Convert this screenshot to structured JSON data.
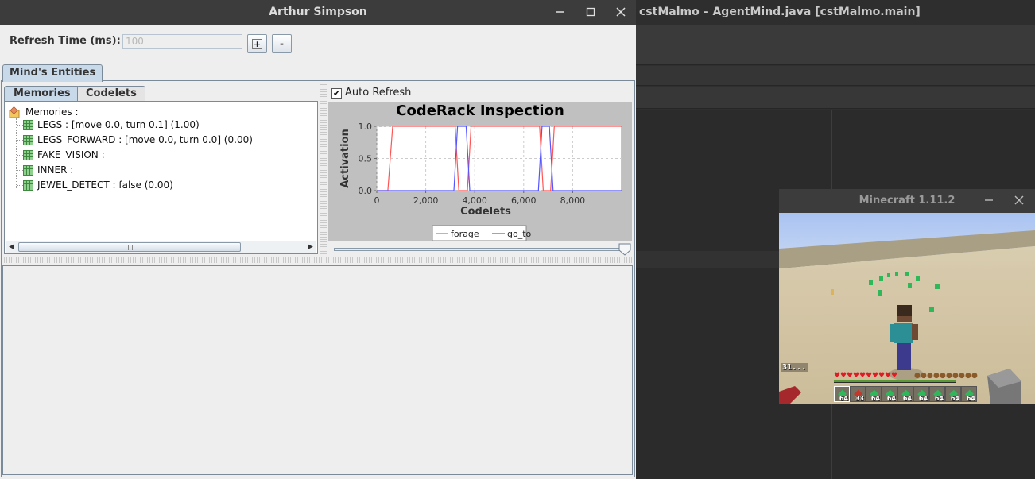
{
  "ide": {
    "title": "cstMalmo – AgentMind.java [cstMalmo.main]"
  },
  "window": {
    "title": "Arthur Simpson",
    "refresh_label": "Refresh Time (ms):",
    "refresh_value": "100",
    "plus_label": "+",
    "minus_label": "-",
    "main_tab": "Mind's Entities",
    "sub_tabs": [
      "Memories",
      "Codelets"
    ],
    "auto_refresh_label": "Auto Refresh",
    "auto_refresh_checked": true,
    "tree": {
      "root": "Memories :",
      "items": [
        "LEGS : [move 0.0, turn 0.1] (1.00)",
        "LEGS_FORWARD : [move 0.0, turn 0.0] (0.00)",
        "FAKE_VISION :",
        "INNER :",
        "JEWEL_DETECT : false (0.00)"
      ]
    },
    "slider_value": 1.0
  },
  "chart_data": {
    "type": "line",
    "title": "CodeRack Inspection",
    "xlabel": "Codelets",
    "ylabel": "Activation",
    "xlim": [
      0,
      10000
    ],
    "ylim": [
      0,
      1.0
    ],
    "xticks": [
      "0",
      "2,000",
      "4,000",
      "6,000",
      "8,000"
    ],
    "yticks": [
      "0.0",
      "0.5",
      "1.0"
    ],
    "grid": true,
    "legend": "bottom-center",
    "series": [
      {
        "name": "forage",
        "color": "#ff5555",
        "points": [
          [
            0,
            0
          ],
          [
            450,
            0
          ],
          [
            650,
            1
          ],
          [
            3200,
            1
          ],
          [
            3350,
            0
          ],
          [
            3700,
            0
          ],
          [
            3850,
            1
          ],
          [
            6650,
            1
          ],
          [
            6800,
            0
          ],
          [
            7100,
            0
          ],
          [
            7250,
            1
          ],
          [
            10000,
            1
          ]
        ]
      },
      {
        "name": "go_to",
        "color": "#5555ff",
        "points": [
          [
            0,
            0
          ],
          [
            3150,
            0
          ],
          [
            3300,
            1
          ],
          [
            3650,
            1
          ],
          [
            3800,
            0
          ],
          [
            6600,
            0
          ],
          [
            6750,
            1
          ],
          [
            7050,
            1
          ],
          [
            7200,
            0
          ],
          [
            10000,
            0
          ]
        ]
      }
    ]
  },
  "minecraft": {
    "title": "Minecraft 1.11.2",
    "fps_text": "31...",
    "hotbar_counts": [
      "64",
      "33",
      "64",
      "64",
      "64",
      "64",
      "64",
      "64",
      "64"
    ]
  }
}
